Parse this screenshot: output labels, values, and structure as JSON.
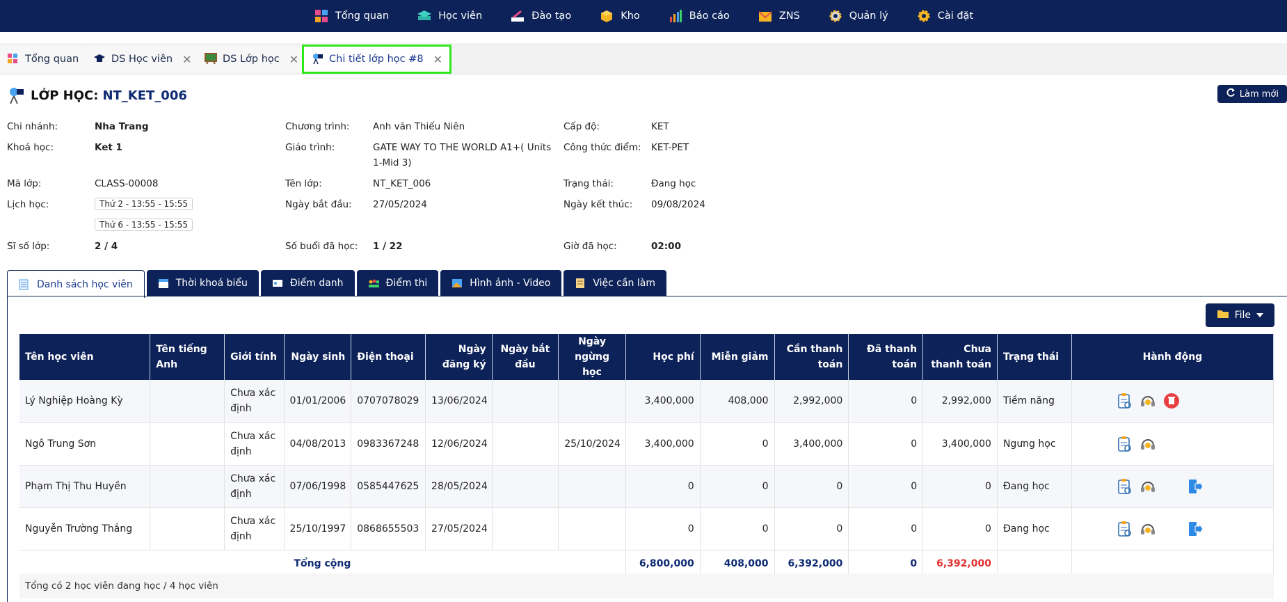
{
  "topnav": [
    {
      "label": "Tổng quan",
      "icon": "dashboard-icon"
    },
    {
      "label": "Học viên",
      "icon": "student-icon"
    },
    {
      "label": "Đào tạo",
      "icon": "training-icon"
    },
    {
      "label": "Kho",
      "icon": "warehouse-icon"
    },
    {
      "label": "Báo cáo",
      "icon": "report-icon"
    },
    {
      "label": "ZNS",
      "icon": "mail-icon"
    },
    {
      "label": "Quản lý",
      "icon": "manage-gear-icon"
    },
    {
      "label": "Cài đặt",
      "icon": "settings-gear-icon"
    }
  ],
  "tabs": [
    {
      "label": "Tổng quan",
      "closable": false
    },
    {
      "label": "DS Học viên",
      "closable": true
    },
    {
      "label": "DS Lớp học",
      "closable": true
    },
    {
      "label": "Chi tiết lớp học #8",
      "closable": true,
      "active": true
    }
  ],
  "tab_close_glyph": "✕",
  "header": {
    "prefix": "LỚP HỌC:",
    "code": "NT_KET_006",
    "refresh_label": "Làm mới"
  },
  "info": {
    "branch_label": "Chi nhánh:",
    "branch": "Nha Trang",
    "course_label": "Khoá học:",
    "course": "Ket 1",
    "class_code_label": "Mã lớp:",
    "class_code": "CLASS-00008",
    "schedule_label": "Lịch học:",
    "schedule": [
      "Thứ 2 - 13:55 - 15:55",
      "Thứ 6 - 13:55 - 15:55"
    ],
    "size_label": "Sĩ số lớp:",
    "size": "2 / 4",
    "program_label": "Chương trình:",
    "program": "Anh văn Thiếu Niên",
    "curriculum_label": "Giáo trình:",
    "curriculum": "GATE WAY TO THE WORLD A1+( Units 1-Mid 3)",
    "class_name_label": "Tên lớp:",
    "class_name": "NT_KET_006",
    "start_label": "Ngày bắt đầu:",
    "start": "27/05/2024",
    "sessions_label": "Số buổi đã học:",
    "sessions": "1 / 22",
    "level_label": "Cấp độ:",
    "level": "KET",
    "formula_label": "Công thức điểm:",
    "formula": "KET-PET",
    "status_label": "Trạng thái:",
    "status": "Đang học",
    "end_label": "Ngày kết thúc:",
    "end": "09/08/2024",
    "hours_label": "Giờ đã học:",
    "hours": "02:00"
  },
  "section_tabs": [
    "Danh sách học viên",
    "Thời khoá biểu",
    "Điểm danh",
    "Điểm thi",
    "Hình ảnh - Video",
    "Việc cần làm"
  ],
  "file_button": "File",
  "table": {
    "headers": [
      "Tên học viên",
      "Tên tiếng Anh",
      "Giới tính",
      "Ngày sinh",
      "Điện thoại",
      "Ngày đăng ký",
      "Ngày bắt đầu",
      "Ngày ngừng học",
      "Học phí",
      "Miễn giảm",
      "Cần thanh toán",
      "Đã thanh toán",
      "Chưa thanh toán",
      "Trạng thái",
      "Hành động"
    ],
    "rows": [
      [
        "Lý Nghiệp Hoàng Kỳ",
        "",
        "Chưa xác định",
        "01/01/2006",
        "0707078029",
        "13/06/2024",
        "",
        "",
        "3,400,000",
        "408,000",
        "2,992,000",
        "0",
        "2,992,000",
        "Tiềm năng"
      ],
      [
        "Ngô Trung Sơn",
        "",
        "Chưa xác định",
        "04/08/2013",
        "0983367248",
        "12/06/2024",
        "",
        "25/10/2024",
        "3,400,000",
        "0",
        "3,400,000",
        "0",
        "3,400,000",
        "Ngưng học"
      ],
      [
        "Phạm Thị Thu Huyền",
        "",
        "Chưa xác định",
        "07/06/1998",
        "0585447625",
        "28/05/2024",
        "",
        "",
        "0",
        "0",
        "0",
        "0",
        "0",
        "Đang học"
      ],
      [
        "Nguyễn Trường Thắng",
        "",
        "Chưa xác định",
        "25/10/1997",
        "0868655503",
        "27/05/2024",
        "",
        "",
        "0",
        "0",
        "0",
        "0",
        "0",
        "Đang học"
      ]
    ],
    "row_actions": [
      [
        "clipboard-icon",
        "headset-icon",
        "delete-icon"
      ],
      [
        "clipboard-icon",
        "headset-icon"
      ],
      [
        "clipboard-icon",
        "headset-icon",
        "transfer-icon"
      ],
      [
        "clipboard-icon",
        "headset-icon",
        "transfer-icon"
      ]
    ],
    "total_label": "Tổng cộng",
    "totals": [
      "6,800,000",
      "408,000",
      "6,392,000",
      "0",
      "6,392,000"
    ]
  },
  "footer_note": "Tổng có 2 học viên đang học / 4 học viên",
  "colors": {
    "navy": "#0d2258",
    "active_tab_border": "#2ee81d",
    "total_red": "#e23030"
  }
}
